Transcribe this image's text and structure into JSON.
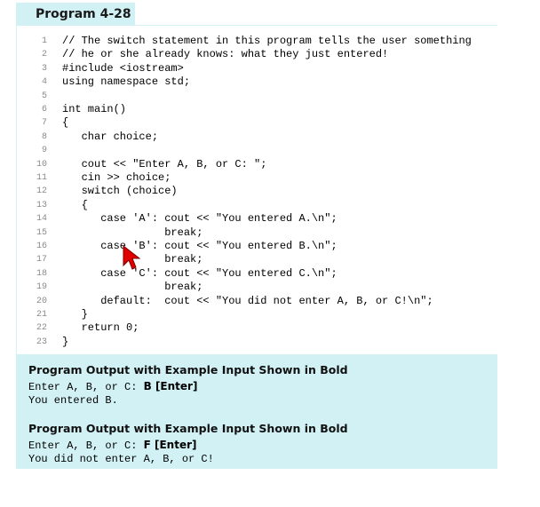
{
  "title": "Program 4-28",
  "code_lines": [
    {
      "num": "1",
      "text": "// The switch statement in this program tells the user something"
    },
    {
      "num": "2",
      "text": "// he or she already knows: what they just entered!"
    },
    {
      "num": "3",
      "text": "#include <iostream>"
    },
    {
      "num": "4",
      "text": "using namespace std;"
    },
    {
      "num": "5",
      "text": ""
    },
    {
      "num": "6",
      "text": "int main()"
    },
    {
      "num": "7",
      "text": "{"
    },
    {
      "num": "8",
      "text": "   char choice;"
    },
    {
      "num": "9",
      "text": ""
    },
    {
      "num": "10",
      "text": "   cout << \"Enter A, B, or C: \";"
    },
    {
      "num": "11",
      "text": "   cin >> choice;"
    },
    {
      "num": "12",
      "text": "   switch (choice)"
    },
    {
      "num": "13",
      "text": "   {"
    },
    {
      "num": "14",
      "text": "      case 'A': cout << \"You entered A.\\n\";"
    },
    {
      "num": "15",
      "text": "                break;"
    },
    {
      "num": "16",
      "text": "      case 'B': cout << \"You entered B.\\n\";"
    },
    {
      "num": "17",
      "text": "                break;"
    },
    {
      "num": "18",
      "text": "      case 'C': cout << \"You entered C.\\n\";"
    },
    {
      "num": "19",
      "text": "                break;"
    },
    {
      "num": "20",
      "text": "      default:  cout << \"You did not enter A, B, or C!\\n\";"
    },
    {
      "num": "21",
      "text": "   }"
    },
    {
      "num": "22",
      "text": "   return 0;"
    },
    {
      "num": "23",
      "text": "}"
    }
  ],
  "outputs": [
    {
      "heading": "Program Output with Example Input Shown in Bold",
      "prompt": "Enter A, B, or C: ",
      "input": "B [Enter]",
      "result": "You entered B."
    },
    {
      "heading": "Program Output with Example Input Shown in Bold",
      "prompt": "Enter A, B, or C: ",
      "input": "F [Enter]",
      "result": "You did not enter A, B, or C!"
    }
  ],
  "colors": {
    "panel": "#d2f1f5",
    "cursor": "#e00000"
  },
  "icons": {
    "cursor": "mouse-pointer-icon"
  }
}
